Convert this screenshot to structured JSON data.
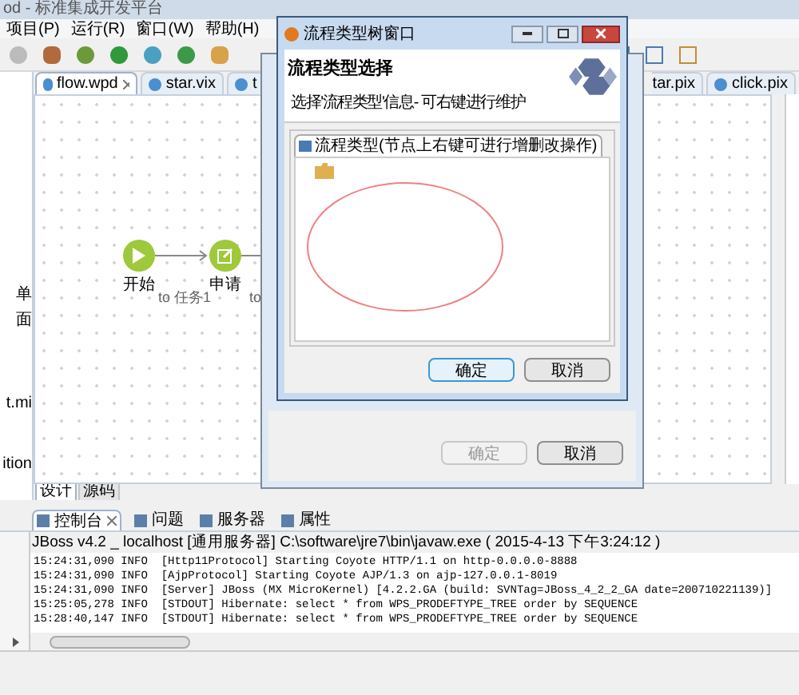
{
  "window": {
    "title": "od - 标准集成开发平台"
  },
  "menu": [
    "项目(P)",
    "运行(R)",
    "窗口(W)",
    "帮助(H)"
  ],
  "editor_tabs_left": [
    {
      "label": "flow.wpd",
      "selected": true,
      "closable": true
    },
    {
      "label": "star.vix",
      "selected": false,
      "closable": false
    },
    {
      "label": "t",
      "selected": false,
      "closable": false
    }
  ],
  "editor_tabs_right": [
    {
      "label": "tar.pix",
      "selected": false,
      "closable": false,
      "cut_left": true
    },
    {
      "label": "click.pix",
      "selected": false,
      "closable": false,
      "cut_left": false
    }
  ],
  "left_panel": [
    "单",
    "面",
    "t.mi",
    "ition"
  ],
  "canvas": {
    "nodes": [
      {
        "kind": "start",
        "label": "开始"
      },
      {
        "kind": "task",
        "label": "申请"
      }
    ],
    "edge_labels": [
      "to 任务1",
      "to"
    ]
  },
  "back_dialog": {
    "buttons": [
      {
        "label": "确定",
        "disabled": true
      },
      {
        "label": "取消",
        "disabled": false
      }
    ]
  },
  "dialog": {
    "title": "流程类型树窗口",
    "heading": "流程类型选择",
    "description": "选择'流程类型'信息- 可右键进行维护",
    "tab": "流程类型(节点上右键可进行增删改操作)",
    "buttons": [
      {
        "label": "确定",
        "default": true
      },
      {
        "label": "取消",
        "default": false
      }
    ]
  },
  "editor_bottom_tabs": [
    {
      "label": "设计",
      "selected": true
    },
    {
      "label": "源码",
      "selected": false
    }
  ],
  "console_tabs": [
    {
      "label": "控制台",
      "selected": true,
      "closable": true
    },
    {
      "label": "问题",
      "selected": false,
      "closable": false
    },
    {
      "label": "服务器",
      "selected": false,
      "closable": false
    },
    {
      "label": "属性",
      "selected": false,
      "closable": false
    }
  ],
  "console": {
    "header": "JBoss v4.2 _ localhost [通用服务器] C:\\software\\jre7\\bin\\javaw.exe ( 2015-4-13 下午3:24:12 )",
    "lines": [
      "15:24:31,090 INFO  [Http11Protocol] Starting Coyote HTTP/1.1 on http-0.0.0.0-8888",
      "15:24:31,090 INFO  [AjpProtocol] Starting Coyote AJP/1.3 on ajp-127.0.0.1-8019",
      "15:24:31,090 INFO  [Server] JBoss (MX MicroKernel) [4.2.2.GA (build: SVNTag=JBoss_4_2_2_GA date=200710221139)]",
      "15:25:05,278 INFO  [STDOUT] Hibernate: select * from WPS_PRODEFTYPE_TREE order by SEQUENCE",
      "15:28:40,147 INFO  [STDOUT] Hibernate: select * from WPS_PRODEFTYPE_TREE order by SEQUENCE"
    ]
  }
}
